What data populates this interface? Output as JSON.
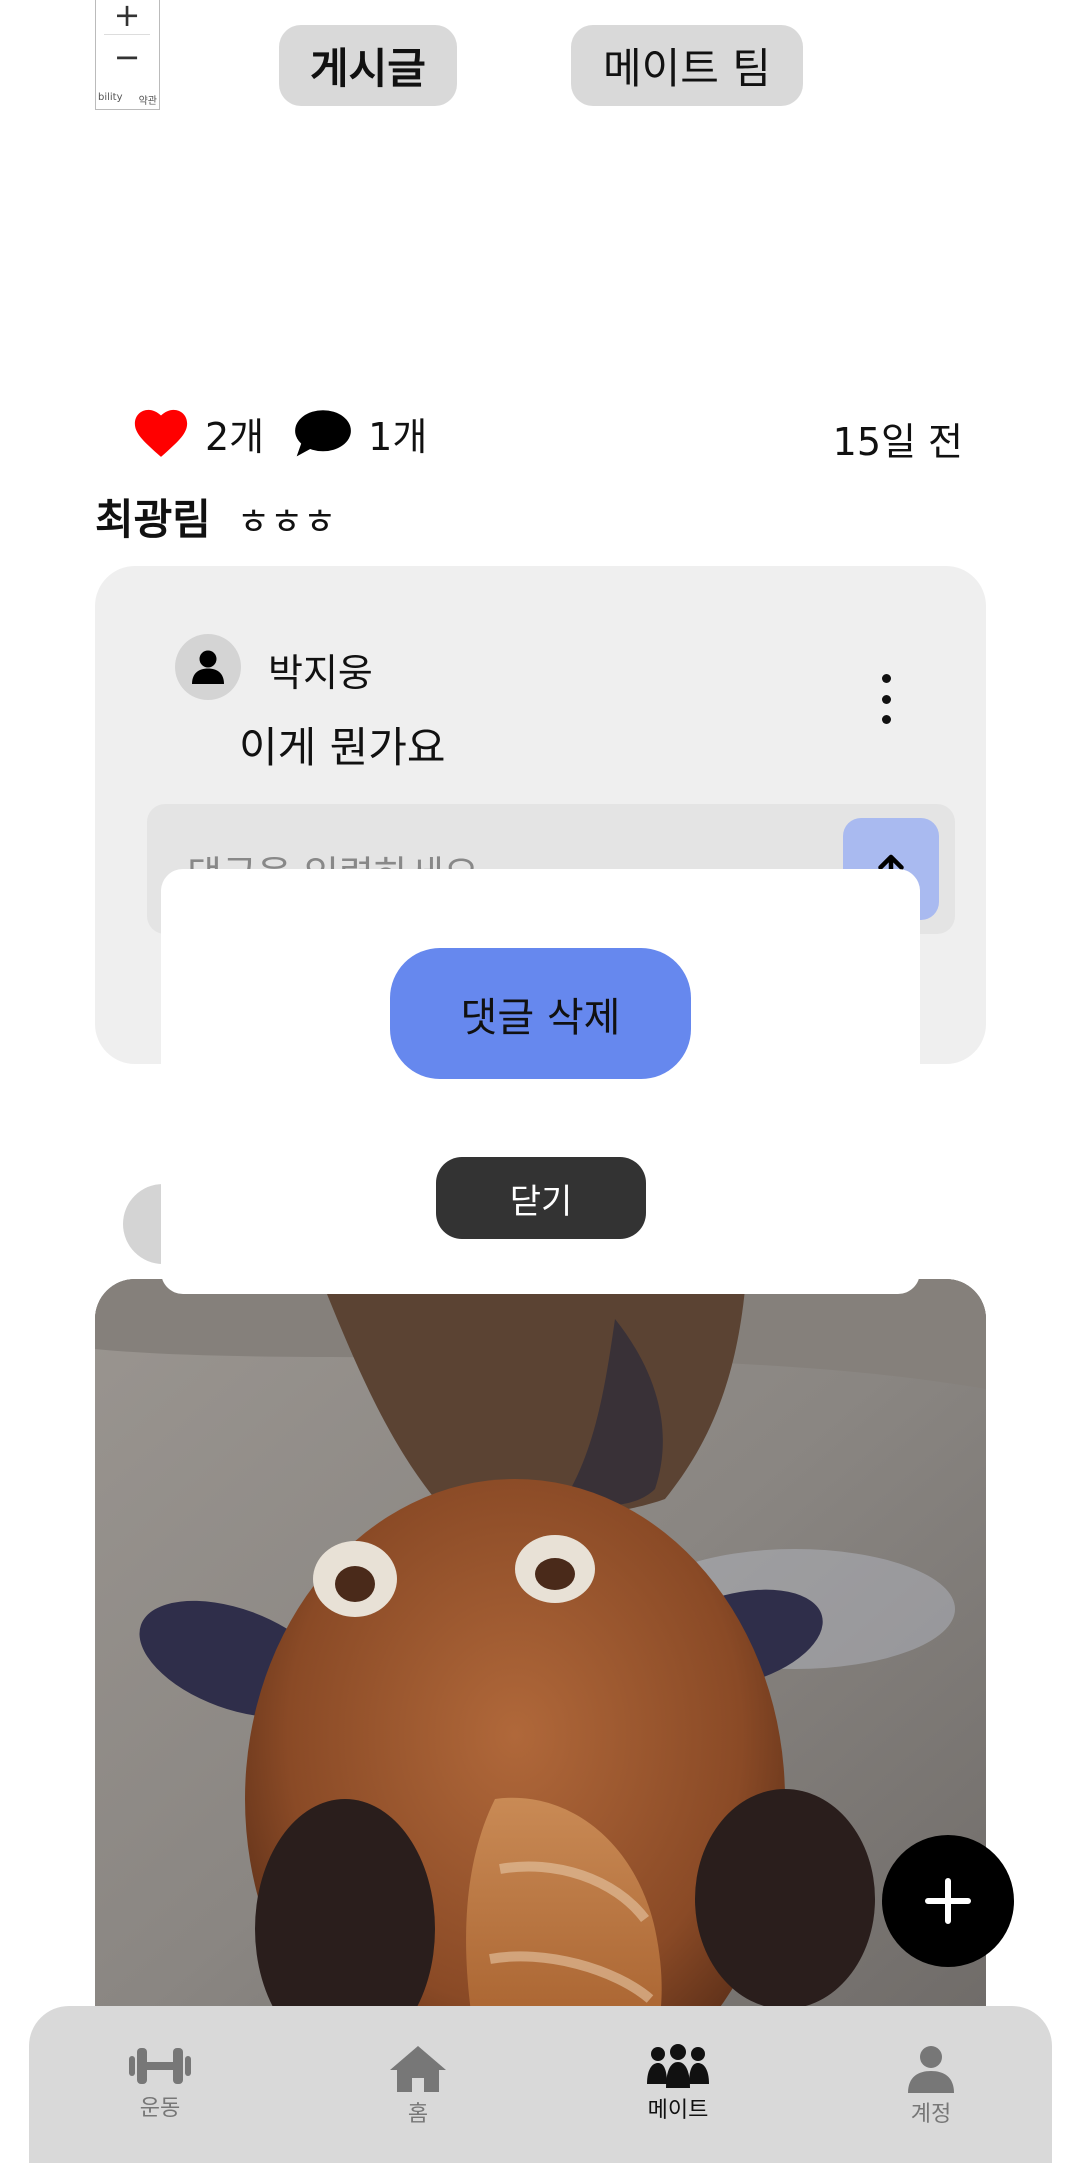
{
  "map": {
    "zoom_in": "+",
    "zoom_out": "−",
    "attribution_left": "bility",
    "attribution_right": "약관"
  },
  "tabs": [
    {
      "label": "게시글",
      "active": true
    },
    {
      "label": "메이트 팀",
      "active": false
    }
  ],
  "post": {
    "likes": "2개",
    "comments": "1개",
    "time_ago": "15일 전",
    "author": "최광림",
    "text": "ㅎㅎㅎ"
  },
  "comment": {
    "author": "박지웅",
    "text": "이게 뭔가요",
    "input_placeholder": "댓글을 입력하세요"
  },
  "modal": {
    "delete_label": "댓글 삭제",
    "close_label": "닫기"
  },
  "fab": {
    "icon": "plus-icon"
  },
  "bottom_nav": [
    {
      "label": "운동",
      "icon": "dumbbell-icon",
      "active": false
    },
    {
      "label": "홈",
      "icon": "home-icon",
      "active": false
    },
    {
      "label": "메이트",
      "icon": "group-icon",
      "active": true
    },
    {
      "label": "계정",
      "icon": "user-icon",
      "active": false
    }
  ],
  "colors": {
    "accent": "#6688ee",
    "send_button": "#a9baf0",
    "like": "#ff0000",
    "nav_bg": "#d9d9d9"
  }
}
